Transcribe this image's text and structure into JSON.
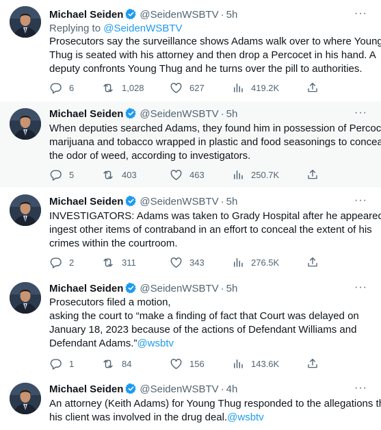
{
  "colors": {
    "accent": "#1d9bf0",
    "secondary_text": "#536471",
    "highlight_bg": "#f7f9f9"
  },
  "icons": {
    "verified": "verified-badge-icon",
    "reply": "reply-icon",
    "retweet": "retweet-icon",
    "like": "heart-icon",
    "views": "views-chart-icon",
    "share": "share-icon",
    "more": "more-options-icon"
  },
  "tweets": [
    {
      "name": "Michael Seiden",
      "handle": "@SeidenWSBTV",
      "dot": "·",
      "time": "5h",
      "more": "···",
      "replying_prefix": "Replying to",
      "replying_to": "@SeidenWSBTV",
      "lines": [
        "Prosecutors say the surveillance shows Adams walk over to where Young",
        "Thug is seated with his attorney and then drop a Percocet in his hand. A",
        "deputy confronts Young Thug and he turns over the pill to authorities."
      ],
      "stats": {
        "replies": "6",
        "retweets": "1,028",
        "likes": "627",
        "views": "419.2K"
      }
    },
    {
      "name": "Michael Seiden",
      "handle": "@SeidenWSBTV",
      "dot": "·",
      "time": "5h",
      "more": "···",
      "lines": [
        "When deputies searched Adams, they found him in possession of Percocet,",
        "marijuana and tobacco wrapped in plastic and food seasonings to conceal",
        "the odor of weed, according to investigators."
      ],
      "stats": {
        "replies": "5",
        "retweets": "403",
        "likes": "463",
        "views": "250.7K"
      }
    },
    {
      "name": "Michael Seiden",
      "handle": "@SeidenWSBTV",
      "dot": "·",
      "time": "5h",
      "more": "···",
      "lines": [
        "INVESTIGATORS: Adams was taken to Grady Hospital after he appeared to",
        "ingest other items of contraband in an effort to conceal the extent of his",
        "crimes within the courtroom."
      ],
      "stats": {
        "replies": "2",
        "retweets": "311",
        "likes": "343",
        "views": "276.5K"
      }
    },
    {
      "name": "Michael Seiden",
      "handle": "@SeidenWSBTV",
      "dot": "·",
      "time": "5h",
      "more": "···",
      "lines": [
        "Prosecutors filed a motion,",
        "asking the court to “make a finding of fact that Court was delayed on",
        "January 18, 2023 because of the actions of Defendant Williams and"
      ],
      "last_line": "Defendant Adams.”",
      "last_link": "@wsbtv",
      "stats": {
        "replies": "1",
        "retweets": "84",
        "likes": "156",
        "views": "143.6K"
      }
    },
    {
      "name": "Michael Seiden",
      "handle": "@SeidenWSBTV",
      "dot": "·",
      "time": "4h",
      "more": "···",
      "lines": [
        "An attorney (Keith Adams) for Young Thug responded to the allegations that"
      ],
      "last_line": "his client was involved in the drug deal.",
      "last_link": "@wsbtv"
    }
  ]
}
